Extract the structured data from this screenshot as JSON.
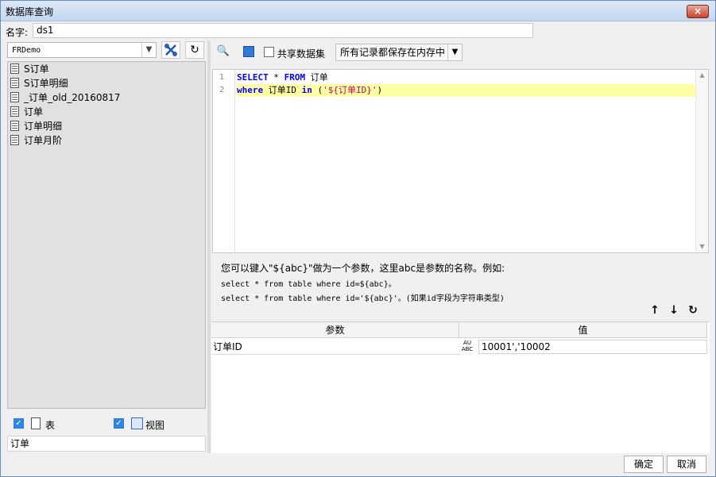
{
  "window": {
    "title": "数据库查询",
    "close_icon": "×"
  },
  "name_field": {
    "label": "名字:",
    "value": "ds1"
  },
  "left_panel": {
    "database": "FRDemo",
    "tables": [
      "S订单",
      "S订单明细",
      "_订单_old_20160817",
      "订单",
      "订单明细",
      "订单月阶"
    ],
    "show_table_label": "表",
    "show_view_label": "视图",
    "filter_value": "订单",
    "checked_glyph": "✓"
  },
  "toolbar": {
    "shared_dataset_label": "共享数据集",
    "memory_option": "所有记录都保存在内存中"
  },
  "editor": {
    "line_numbers": [
      "1",
      "2"
    ],
    "line1": {
      "kw1": "SELECT",
      "t1": " * ",
      "kw2": "FROM",
      "t2": " 订单"
    },
    "line2": {
      "kw1": "where",
      "t1": " 订单ID ",
      "kw2": "in",
      "t2": " (",
      "str": "'${订单ID}'",
      "t3": ")"
    },
    "scroll_up": "▲",
    "scroll_down": "▼"
  },
  "help_text": {
    "line1": "您可以键入\"${abc}\"做为一个参数，这里abc是参数的名称。例如:",
    "line2": "select * from table where id=${abc}。",
    "line3": "select * from table where id='${abc}'。(如果id字段为字符串类型)"
  },
  "params": {
    "header_param": "参数",
    "header_value": "值",
    "rows": [
      {
        "name": "订单ID",
        "value": "10001','10002"
      }
    ],
    "type_badge_top": "AU",
    "type_badge_bottom": "ABC"
  },
  "footer": {
    "ok": "确定",
    "cancel": "取消"
  }
}
